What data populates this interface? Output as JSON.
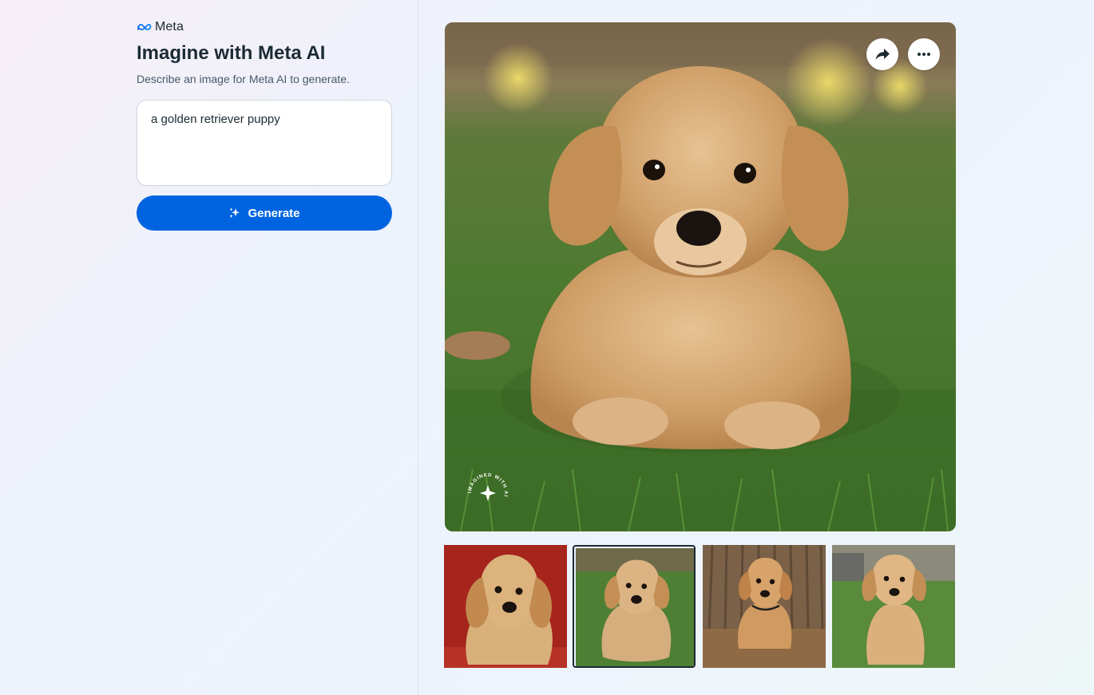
{
  "brand": {
    "name": "Meta",
    "logo_icon": "meta-infinity-logo"
  },
  "header": {
    "title": "Imagine with Meta AI",
    "subtitle": "Describe an image for Meta AI to generate."
  },
  "prompt": {
    "value": "a golden retriever puppy"
  },
  "generate_button": {
    "label": "Generate",
    "icon": "sparkle-icon"
  },
  "image_actions": {
    "share_icon": "share-arrow-icon",
    "more_icon": "more-dots-icon"
  },
  "watermark": {
    "text": "IMAGINED WITH AI"
  },
  "thumbnails": {
    "count": 4,
    "selected_index": 1,
    "items": [
      {
        "subject": "golden retriever puppy",
        "background": "red"
      },
      {
        "subject": "golden retriever puppy",
        "background": "grass"
      },
      {
        "subject": "golden retriever puppy",
        "background": "wooden wall"
      },
      {
        "subject": "golden retriever puppy",
        "background": "grass"
      }
    ]
  },
  "colors": {
    "accent": "#0064e0",
    "text_primary": "#1c2b33",
    "text_secondary": "#465a69",
    "selected_border": "#1c2b33"
  }
}
